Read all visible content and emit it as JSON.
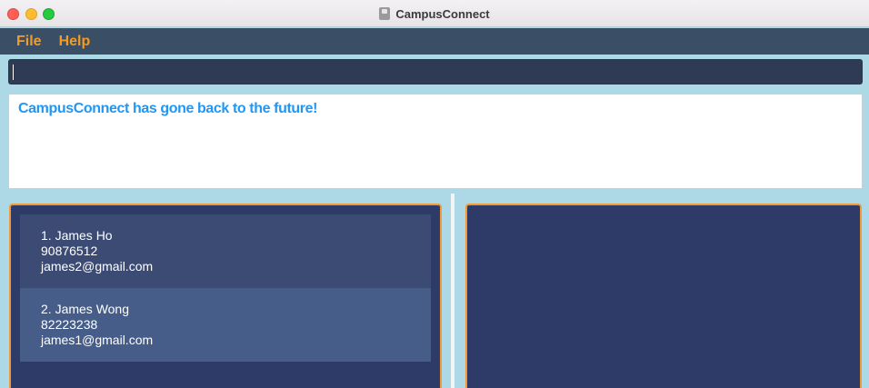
{
  "window": {
    "title": "CampusConnect",
    "app_icon": "app-window-icon"
  },
  "menu": {
    "items": [
      {
        "label": "File"
      },
      {
        "label": "Help"
      }
    ]
  },
  "command": {
    "value": "",
    "placeholder": ""
  },
  "result": {
    "message": "CampusConnect has gone back to the future!"
  },
  "persons": [
    {
      "index_name": "1. James Ho",
      "phone": "90876512",
      "email": "james2@gmail.com"
    },
    {
      "index_name": "2. James Wong",
      "phone": "82223238",
      "email": "james1@gmail.com"
    }
  ],
  "colors": {
    "background": "#add8e6",
    "menu_bar": "#3a4e66",
    "menu_text": "#f39c25",
    "command_box": "#2e3b55",
    "result_text": "#2196f3",
    "panel": "#2e3b68",
    "panel_border": "#f29933",
    "card_odd": "#3c4b73",
    "card_even": "#465d89"
  }
}
